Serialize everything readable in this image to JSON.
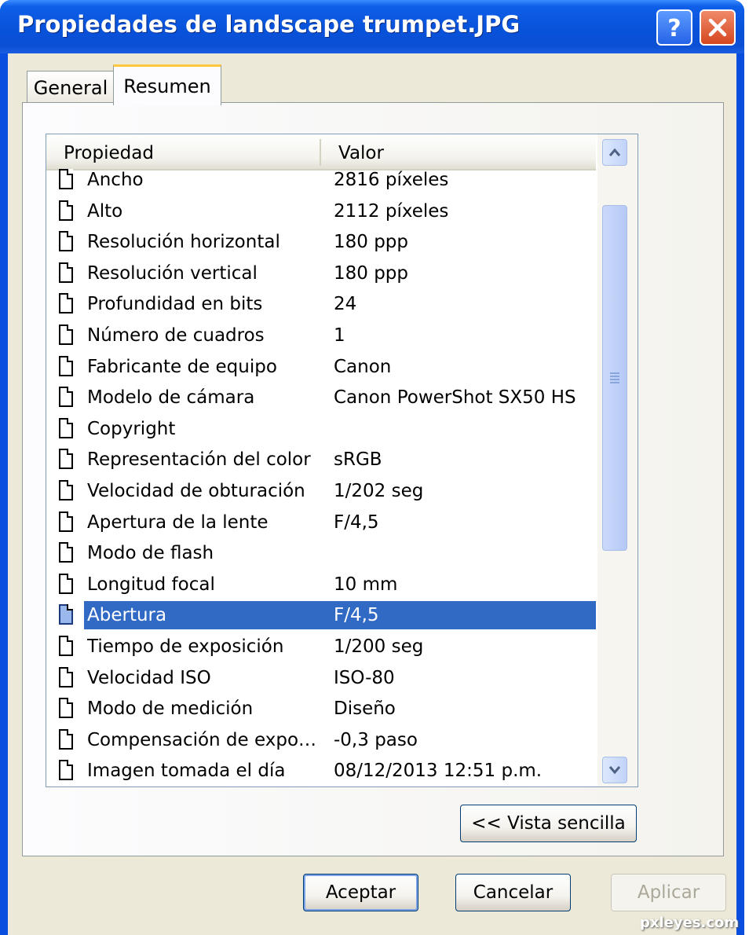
{
  "window": {
    "title": "Propiedades de landscape trumpet.JPG"
  },
  "title_buttons": {
    "help_icon": "help-question-icon",
    "close_icon": "close-x-icon"
  },
  "tabs": [
    {
      "label": "General"
    },
    {
      "label": "Resumen"
    }
  ],
  "list": {
    "columns": {
      "property": "Propiedad",
      "value": "Valor"
    },
    "rows": [
      {
        "property": "Ancho",
        "value": "2816 píxeles"
      },
      {
        "property": "Alto",
        "value": "2112 píxeles"
      },
      {
        "property": "Resolución horizontal",
        "value": "180 ppp"
      },
      {
        "property": "Resolución vertical",
        "value": "180 ppp"
      },
      {
        "property": "Profundidad en bits",
        "value": "24"
      },
      {
        "property": "Número de cuadros",
        "value": "1"
      },
      {
        "property": "Fabricante de equipo",
        "value": "Canon"
      },
      {
        "property": "Modelo de cámara",
        "value": "Canon PowerShot SX50 HS"
      },
      {
        "property": "Copyright",
        "value": ""
      },
      {
        "property": "Representación del color",
        "value": "sRGB"
      },
      {
        "property": "Velocidad de obturación",
        "value": "1/202 seg"
      },
      {
        "property": "Apertura de la lente",
        "value": "F/4,5"
      },
      {
        "property": "Modo de flash",
        "value": ""
      },
      {
        "property": "Longitud focal",
        "value": "10 mm"
      },
      {
        "property": "Abertura",
        "value": "F/4,5",
        "selected": true
      },
      {
        "property": "Tiempo de exposición",
        "value": "1/200 seg"
      },
      {
        "property": "Velocidad ISO",
        "value": "ISO-80"
      },
      {
        "property": "Modo de medición",
        "value": "Diseño"
      },
      {
        "property": "Compensación de expo…",
        "value": "-0,3 paso"
      },
      {
        "property": "Imagen tomada el día",
        "value": "08/12/2013 12:51 p.m."
      }
    ]
  },
  "buttons": {
    "vista": "<< Vista sencilla",
    "aceptar": "Aceptar",
    "cancelar": "Cancelar",
    "aplicar": "Aplicar"
  },
  "watermark": "pxleyes.com"
}
